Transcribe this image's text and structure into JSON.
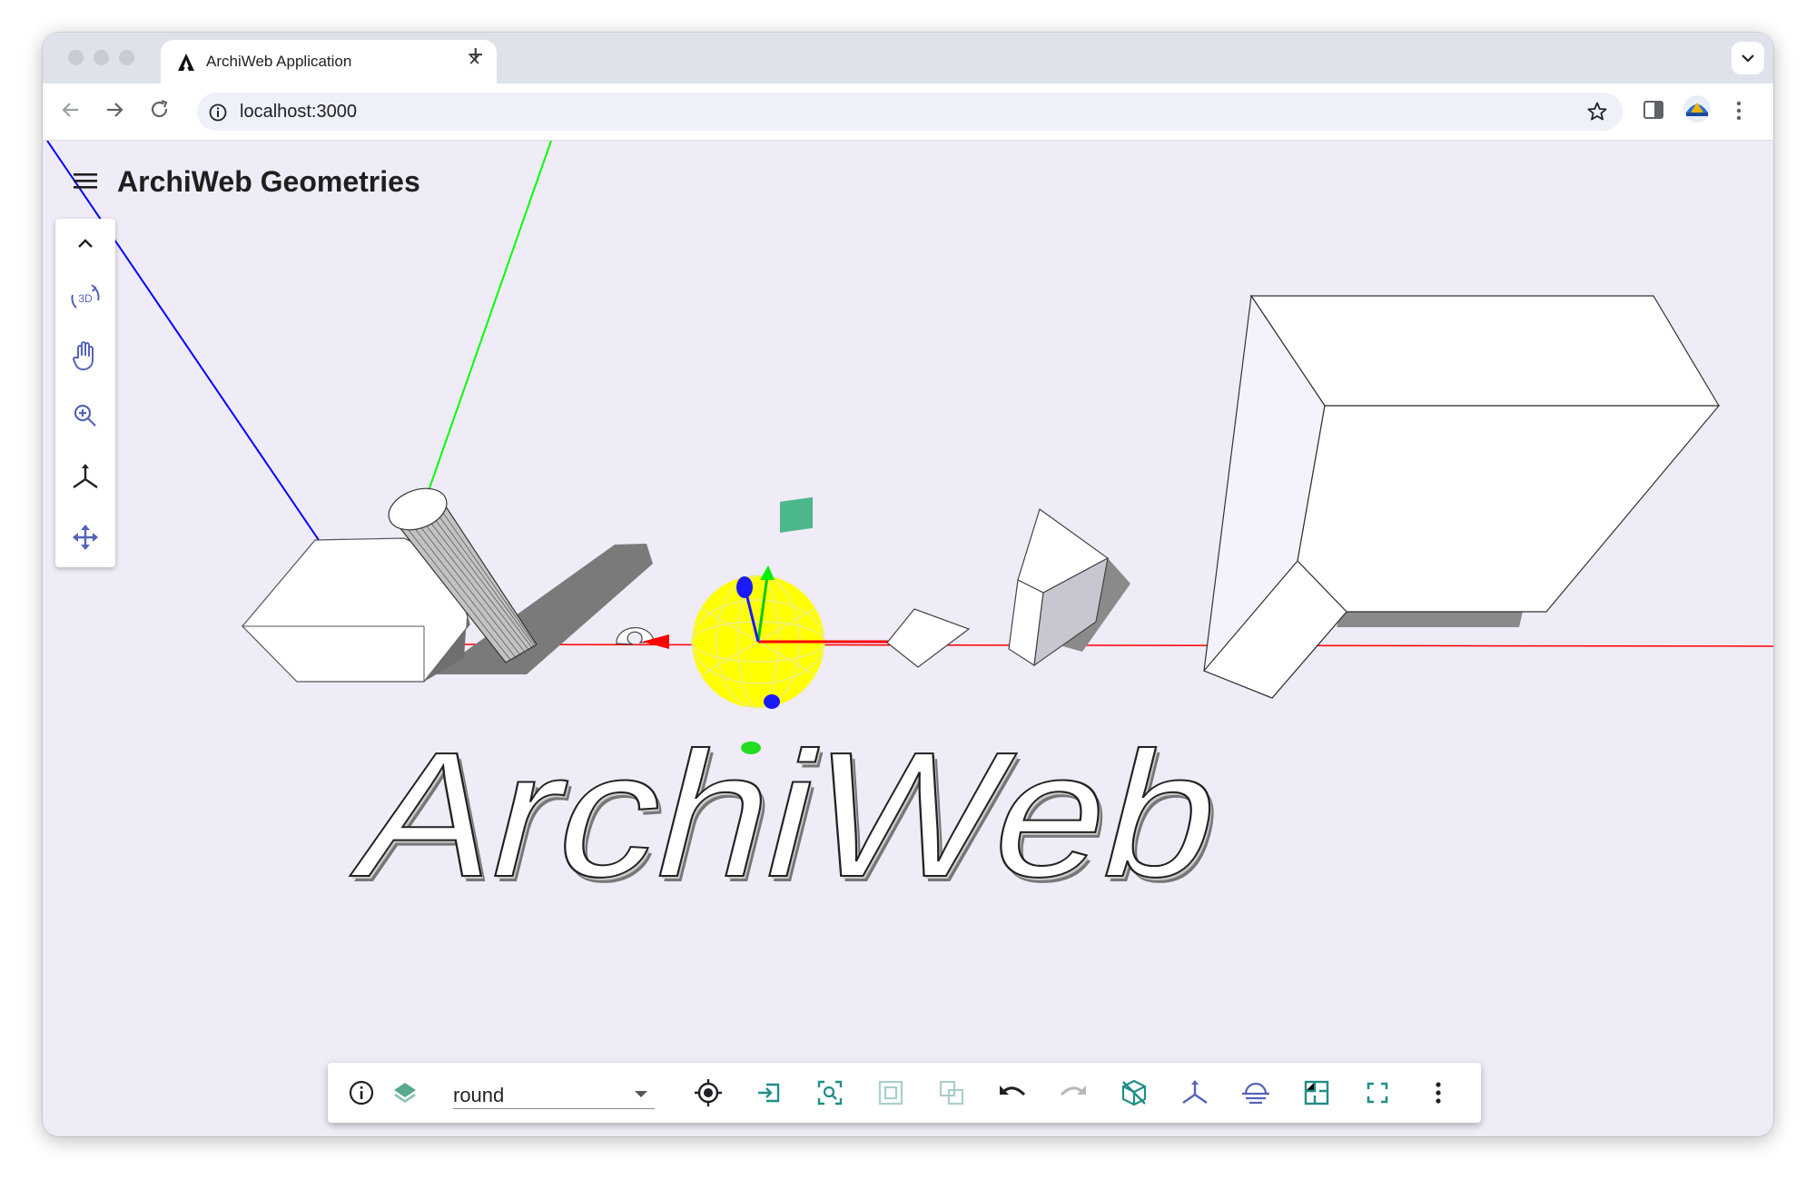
{
  "browser": {
    "tab_title": "ArchiWeb Application",
    "tab_close": "×",
    "new_tab": "+",
    "url": "localhost:3000"
  },
  "app": {
    "title": "ArchiWeb Geometries",
    "scene_text": "ArchiWeb",
    "left_toolbar": [
      "collapse-icon",
      "orbit-3d-icon",
      "pan-hand-icon",
      "zoom-icon",
      "axes-icon",
      "move-icon"
    ],
    "orbit_label": "3D"
  },
  "bottom_bar": {
    "layer_value": "round",
    "buttons": [
      "info-icon",
      "layers-icon",
      "target-icon",
      "import-icon",
      "zoom-fit-icon",
      "group-icon",
      "ungroup-icon",
      "undo-icon",
      "redo-icon",
      "hide-box-icon",
      "axes-icon",
      "section-plane-icon",
      "floorplan-icon",
      "fullscreen-icon",
      "more-vert-icon"
    ]
  },
  "colors": {
    "viewport_bg": "#efebf7",
    "accent_teal": "#1f8f86",
    "accent_indigo": "#5463b8",
    "axis_x": "#ff0000",
    "axis_y": "#00ff00",
    "axis_z": "#0000ff",
    "sphere": "#ffff00"
  }
}
